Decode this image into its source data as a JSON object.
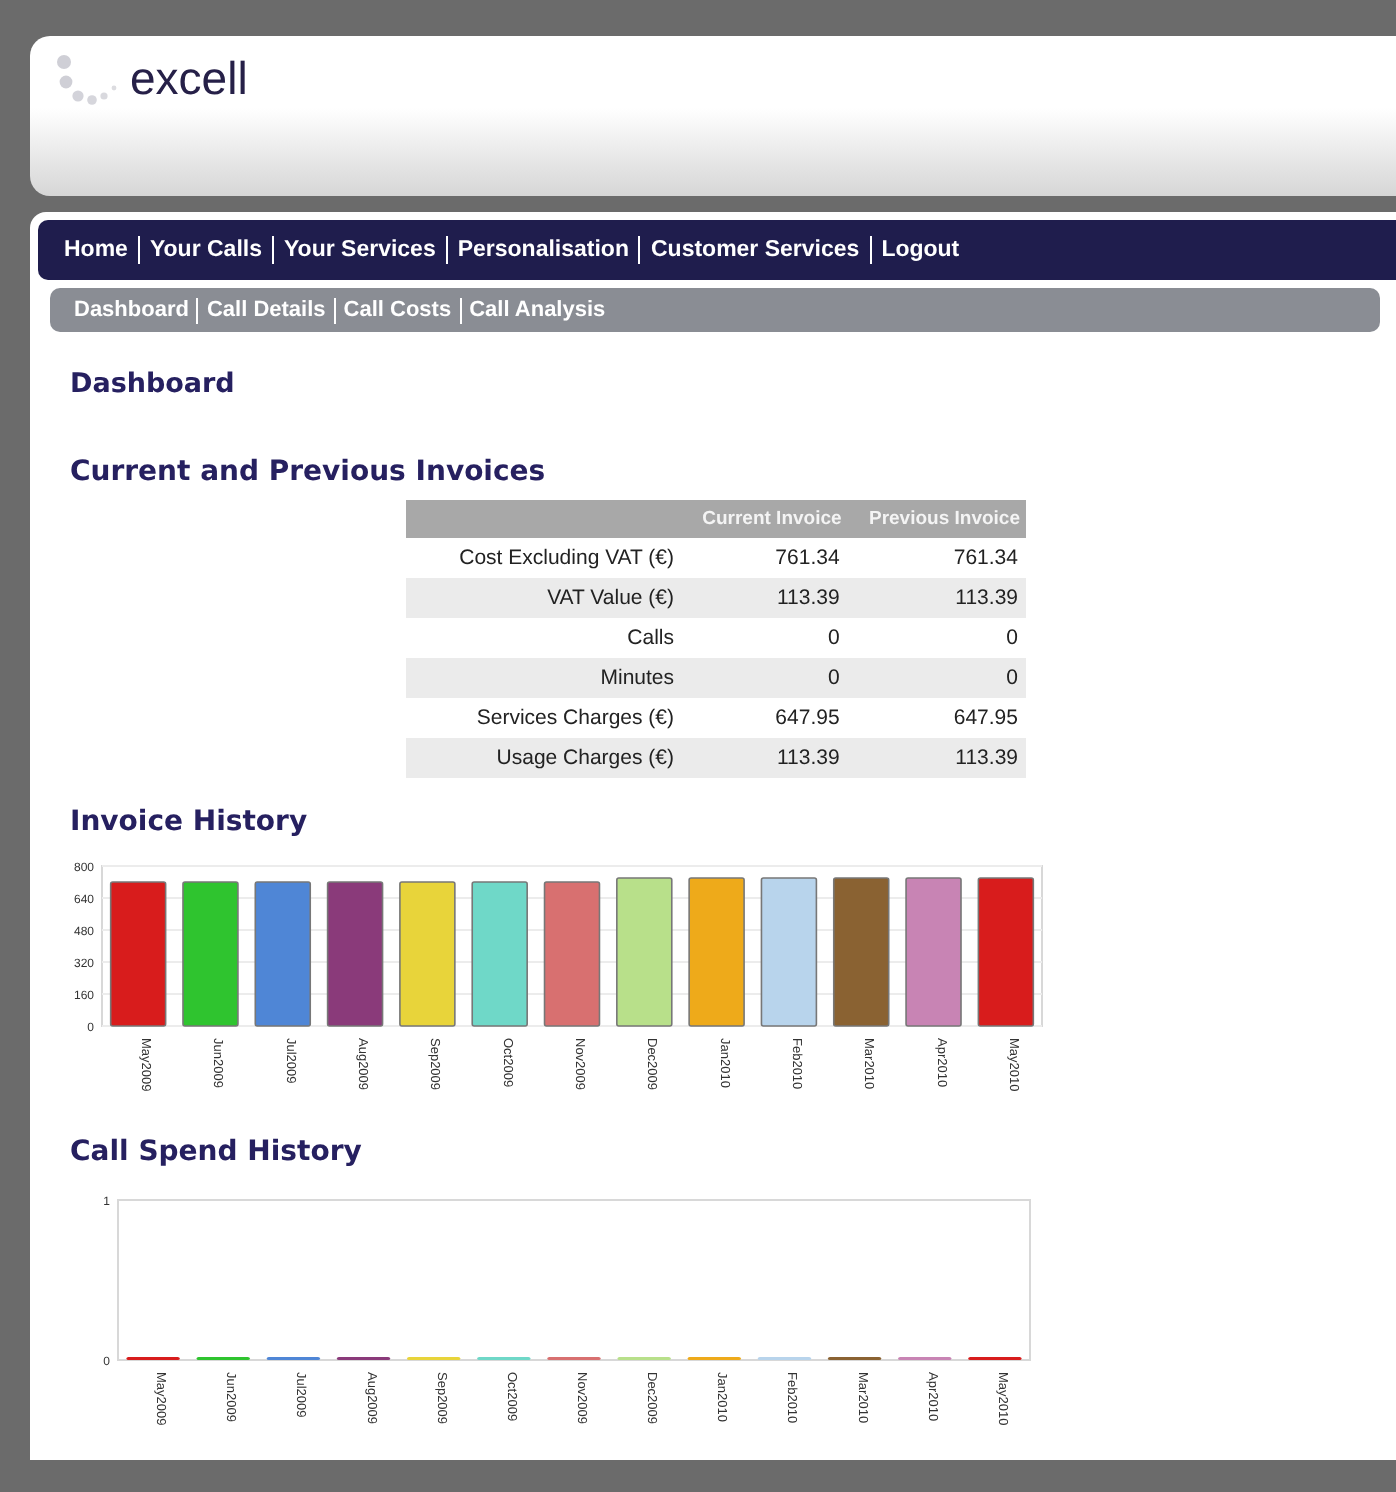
{
  "header": {
    "logo": "excell"
  },
  "nav": {
    "items": [
      {
        "label": "Home"
      },
      {
        "label": "Your Calls"
      },
      {
        "label": "Your Services"
      },
      {
        "label": "Personalisation"
      },
      {
        "label": "Customer Services"
      },
      {
        "label": "Logout"
      }
    ]
  },
  "subnav": {
    "items": [
      {
        "label": "Dashboard"
      },
      {
        "label": "Call Details"
      },
      {
        "label": "Call Costs"
      },
      {
        "label": "Call Analysis"
      }
    ]
  },
  "page_title": "Dashboard",
  "invoices": {
    "title": "Current and Previous Invoices",
    "columns": [
      "Current Invoice",
      "Previous Invoice"
    ],
    "rows": [
      {
        "label": "Cost Excluding VAT (€)",
        "current": "761.34",
        "previous": "761.34"
      },
      {
        "label": "VAT Value (€)",
        "current": "113.39",
        "previous": "113.39"
      },
      {
        "label": "Calls",
        "current": "0",
        "previous": "0"
      },
      {
        "label": "Minutes",
        "current": "0",
        "previous": "0"
      },
      {
        "label": "Services Charges (€)",
        "current": "647.95",
        "previous": "647.95"
      },
      {
        "label": "Usage Charges (€)",
        "current": "113.39",
        "previous": "113.39"
      }
    ]
  },
  "invoice_history": {
    "title": "Invoice History",
    "chart_data": {
      "type": "bar",
      "categories": [
        "May2009",
        "Jun2009",
        "Jul2009",
        "Aug2009",
        "Sep2009",
        "Oct2009",
        "Nov2009",
        "Dec2009",
        "Jan2010",
        "Feb2010",
        "Mar2010",
        "Apr2010",
        "May2010"
      ],
      "values": [
        720,
        720,
        720,
        720,
        720,
        720,
        720,
        740,
        740,
        740,
        740,
        740,
        740
      ],
      "colors": [
        "#d81c1c",
        "#2fc42f",
        "#4f86d6",
        "#8a3a7a",
        "#e8d43a",
        "#6fd8c8",
        "#d87070",
        "#b8e08a",
        "#eeaa1a",
        "#b8d4ec",
        "#8a6232",
        "#c884b4",
        "#d81c1c"
      ],
      "ylim": [
        0,
        800
      ],
      "yticks": [
        0,
        160,
        320,
        480,
        640,
        800
      ],
      "grid": true
    }
  },
  "call_spend_history": {
    "title": "Call Spend History",
    "chart_data": {
      "type": "bar",
      "categories": [
        "May2009",
        "Jun2009",
        "Jul2009",
        "Aug2009",
        "Sep2009",
        "Oct2009",
        "Nov2009",
        "Dec2009",
        "Jan2010",
        "Feb2010",
        "Mar2010",
        "Apr2010",
        "May2010"
      ],
      "values": [
        0,
        0,
        0,
        0,
        0,
        0,
        0,
        0,
        0,
        0,
        0,
        0,
        0
      ],
      "colors": [
        "#d81c1c",
        "#2fc42f",
        "#4f86d6",
        "#8a3a7a",
        "#e8d43a",
        "#6fd8c8",
        "#d87070",
        "#b8e08a",
        "#eeaa1a",
        "#b8d4ec",
        "#8a6232",
        "#c884b4",
        "#d81c1c"
      ],
      "ylim": [
        0,
        1
      ],
      "yticks": [
        0,
        1
      ]
    }
  }
}
